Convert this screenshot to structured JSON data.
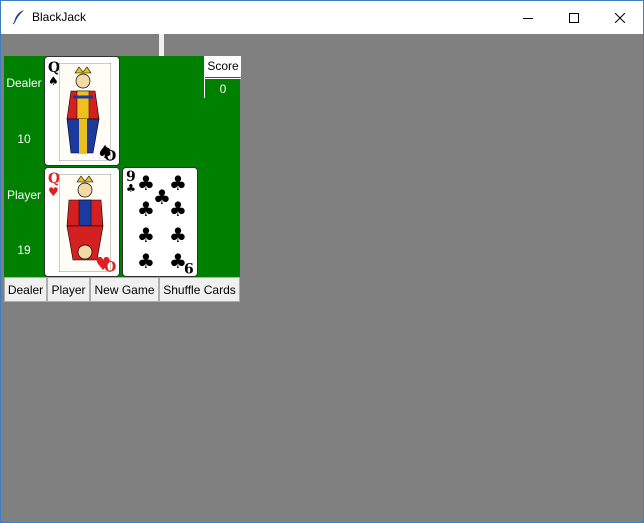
{
  "window": {
    "title": "BlackJack"
  },
  "icons": {
    "app": "feather-icon",
    "minimize": "minimize-icon",
    "maximize": "maximize-icon",
    "close": "close-icon"
  },
  "table": {
    "color": "#008000",
    "dealer_label": "Dealer",
    "dealer_total": "10",
    "player_label": "Player",
    "player_total": "19",
    "dealer_cards": [
      {
        "rank": "Q",
        "suit": "♠",
        "color": "#000000"
      }
    ],
    "player_cards": [
      {
        "rank": "Q",
        "suit": "♥",
        "color": "#e02020"
      },
      {
        "rank": "9",
        "suit": "♣",
        "color": "#000000"
      }
    ]
  },
  "score": {
    "label": "Score",
    "value": "0"
  },
  "buttons": {
    "dealer": "Dealer",
    "player": "Player",
    "new_game": "New Game",
    "shuffle": "Shuffle Cards"
  }
}
